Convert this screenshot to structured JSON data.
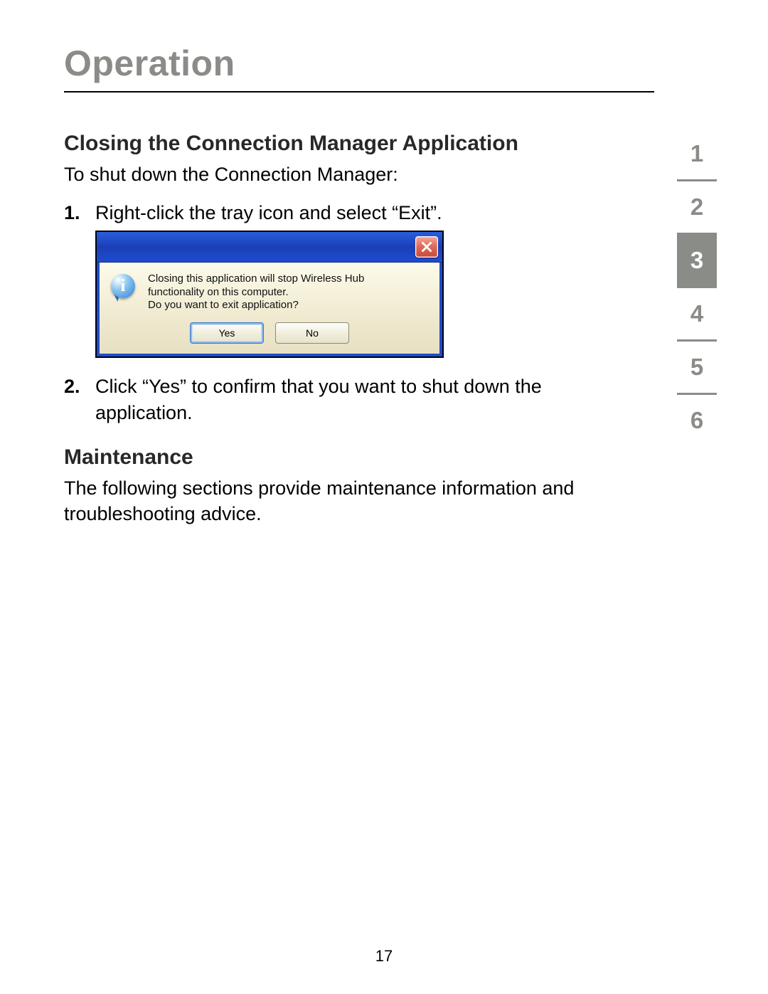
{
  "page": {
    "title": "Operation",
    "number": "17"
  },
  "sections": {
    "closing": {
      "heading": "Closing the Connection Manager Application",
      "intro": "To shut down the Connection Manager:",
      "steps": [
        {
          "num": "1.",
          "text": "Right-click the tray icon and select “Exit”."
        },
        {
          "num": "2.",
          "text": "Click “Yes” to confirm that you want to shut down the application."
        }
      ]
    },
    "maintenance": {
      "heading": "Maintenance",
      "body": "The following sections provide maintenance information and troubleshooting advice."
    }
  },
  "dialog": {
    "message_line1": "Closing this application will stop Wireless Hub",
    "message_line2": "functionality on this computer.",
    "message_line3": "Do you want to exit application?",
    "info_glyph": "i",
    "yes": "Yes",
    "no": "No"
  },
  "nav": {
    "current": "3",
    "items": [
      "1",
      "2",
      "3",
      "4",
      "5",
      "6"
    ]
  }
}
